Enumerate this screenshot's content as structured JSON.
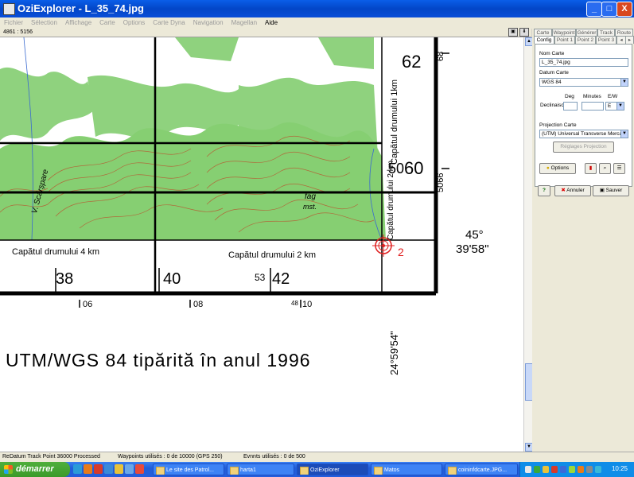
{
  "window": {
    "title": "OziExplorer - L_35_74.jpg",
    "min": "_",
    "max": "□",
    "close": "X"
  },
  "menu": [
    {
      "label": "Fichier",
      "enabled": false
    },
    {
      "label": "Sélection",
      "enabled": false
    },
    {
      "label": "Affichage",
      "enabled": false
    },
    {
      "label": "Carte",
      "enabled": false
    },
    {
      "label": "Options",
      "enabled": false
    },
    {
      "label": "Carte Dyna",
      "enabled": false
    },
    {
      "label": "Navigation",
      "enabled": false
    },
    {
      "label": "Magellan",
      "enabled": false
    },
    {
      "label": "Aide",
      "enabled": true
    }
  ],
  "cursor_coords": "4861 : 5156",
  "map": {
    "grid_top": {
      "n62": "62",
      "n68": "68",
      "n5060": "5060",
      "n5066": "5066",
      "n50": "50",
      "n60": "60",
      "n66": "66"
    },
    "text_capatul_1km": "Capătul drumului 1km",
    "text_capatul_2km_v": "Capătul drumului 2 km",
    "text_capatul_4km": "Capătul drumului 4 km",
    "text_capatul_2km_h": "Capătul drumului 2 km",
    "text_fag": "fag",
    "text_mst": "mst.",
    "text_scarspea": "V. Scărșpare",
    "bottom_nums": [
      "38",
      "40",
      "42"
    ],
    "label_53": "53",
    "lower_nums": [
      "06",
      "08",
      "10"
    ],
    "label_48": "48",
    "lat_deg": "45°",
    "lat_min": "39'58\"",
    "lon": "24°59'54\"",
    "calib_point": "2",
    "caption": "UTM/WGS 84 tipărită în anul 1996"
  },
  "panel": {
    "tabs_row1": [
      "Carte",
      "Waypoint",
      "Générer",
      "Track",
      "Route"
    ],
    "tabs_row2": [
      "Config",
      "Point 1",
      "Point 2",
      "Point 3"
    ],
    "nom_carte_label": "Nom Carte",
    "nom_carte_value": "L_35_74.jpg",
    "datum_label": "Datum Carte",
    "datum_value": "WGS 84",
    "deg_label": "Deg",
    "minutes_label": "Minutes",
    "ew_label": "E/W",
    "declinaison_label": "Declinaisc",
    "ew_value": "E",
    "projection_label": "Projection Carte",
    "projection_value": "(UTM) Universal Transverse Mercator",
    "reglages_btn": "Réglages Projection",
    "options_btn": "Options",
    "annuler_btn": "Annuler",
    "sauver_btn": "Sauver",
    "help_btn": "?"
  },
  "status": {
    "redatum": "ReDatum Track Point 36000 Processed",
    "waypoints": "Waypoints utilisés : 0 de 10000  (GPS 250)",
    "events": "Evnnts utilisés : 0 de 500"
  },
  "taskbar": {
    "start": "démarrer",
    "tasks": [
      "Le site des Patrol...",
      "harta1",
      "OziExplorer",
      "Matos",
      "coininfdcarte.JPG..."
    ],
    "clock": "10:25"
  },
  "colors": {
    "forest": "#7cc86e",
    "contour": "#b06a3a",
    "grid": "#000000",
    "calib": "#e02020",
    "titlebar": "#0a5ee8"
  }
}
